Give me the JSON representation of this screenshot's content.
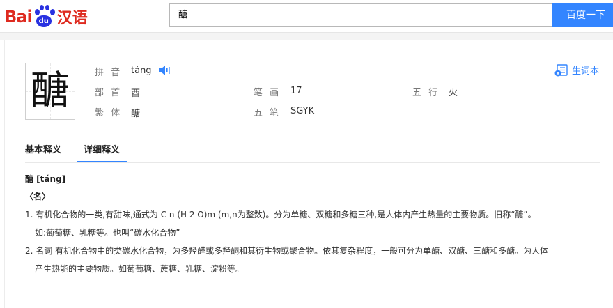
{
  "logo": {
    "bai": "Bai",
    "du": "du",
    "hanyu": "汉语"
  },
  "search": {
    "value": "醣",
    "button": "百度一下"
  },
  "char": "醣",
  "info": {
    "pinyin_label": "拼 音",
    "pinyin": "táng",
    "bushou_label": "部 首",
    "bushou": "酉",
    "fanti_label": "繁 体",
    "fanti": "醣",
    "bihua_label": "笔 画",
    "bihua": "17",
    "wuxing_label": "五 行",
    "wuxing": "火",
    "wubi_label": "五 笔",
    "wubi": "SGYK"
  },
  "newword_label": "生词本",
  "tabs": {
    "basic": "基本释义",
    "detail": "详细释义"
  },
  "definition": {
    "head": "醣 [táng]",
    "pos": "〈名〉",
    "line1": "1. 有机化合物的一类,有甜味,通式为 C n (H 2 O)m (m,n为整数)。分为单糖、双糖和多糖三种,是人体内产生热量的主要物质。旧称“醣”。",
    "line1b": "如:葡萄糖、乳糖等。也叫“碳水化合物”",
    "line2": "2. 名词 有机化合物中的类碳水化合物，为多羟醛或多羟酮和其衍生物或聚合物。依其复杂程度，一般可分为单醣、双醣、三醣和多醣。为人体",
    "line2b": "产生热能的主要物质。如葡萄糖、蔗糖、乳糖、淀粉等。"
  }
}
